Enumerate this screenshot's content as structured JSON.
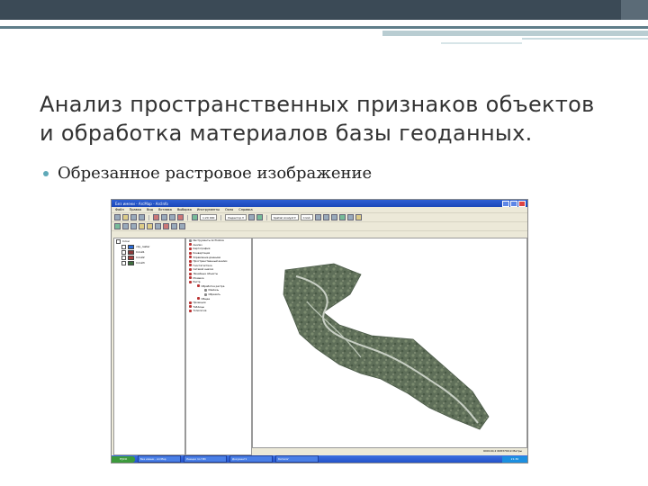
{
  "slide": {
    "title_line1": "Анализ пространственных признаков объектов",
    "title_line2": "и обработка материалов базы геоданных.",
    "bullet": "Обрезанное растровое изображение"
  },
  "app": {
    "window_title": "Без имени - ArcMap - ArcInfo",
    "menu": [
      "Файл",
      "Правка",
      "Вид",
      "Вставка",
      "Выборка",
      "Инструменты",
      "Окно",
      "Справка"
    ],
    "editor_label": "Редактор ▾",
    "scale": "1:20 000",
    "spatial_analyst_label": "Spatial Analyst ▾",
    "layer_combo": "Слой:",
    "toc": {
      "root": "Слои",
      "layers": [
        {
          "label": "clip_raster",
          "color": "#2a6bd6"
        },
        {
          "label": "Слой1",
          "color": "#8c3a3a"
        },
        {
          "label": "Слой2",
          "color": "#a84040"
        },
        {
          "label": "Слой3",
          "color": "#3f6f3f"
        }
      ]
    },
    "catalog_items": [
      "Инструменты ArcToolbox",
      "Анализ",
      "Картография",
      "Конвертация",
      "Управление данными",
      "Пространственный анализ",
      "Геостатистика",
      "Сетевой анализ",
      "Линейные объекты",
      "Мозаика",
      "Растр",
      "Обработка растра",
      "Извлечь",
      "Обрезать",
      "Общее",
      "Проекции",
      "Таблицы",
      "Топология"
    ],
    "tabs": [
      "Отображение",
      "Источник",
      "Выборка"
    ],
    "catalog_tabs": [
      "Избранное",
      "Указатель",
      "Поиск"
    ],
    "status_coords": "600140,2  6083790,9 Метры",
    "taskbar": {
      "start": "пуск",
      "tasks": [
        "Без имени - ArcMap",
        "Лекции по ГИС",
        "Документ1",
        "Каталог"
      ],
      "clock": "21:30"
    }
  }
}
